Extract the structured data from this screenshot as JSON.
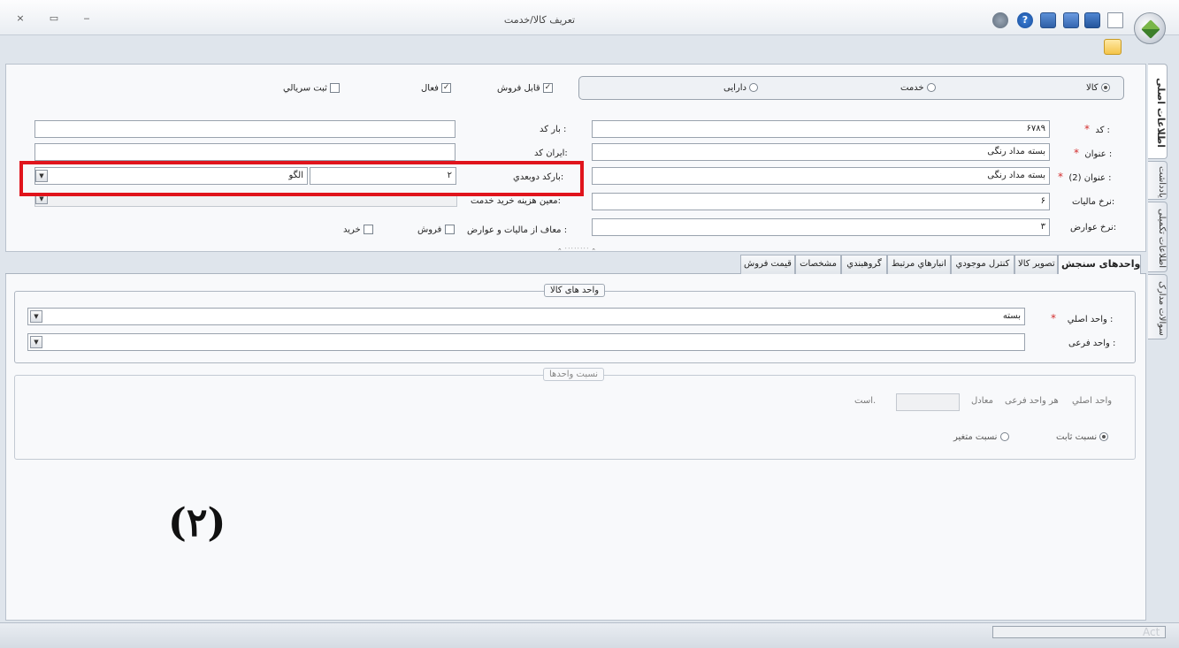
{
  "window": {
    "title": "تعریف کالا/خدمت",
    "buttons": {
      "close": "×",
      "restore": "▭",
      "minimize": "‒"
    }
  },
  "toolbar": {
    "icons": [
      "new-document-icon",
      "save-icon",
      "save-as-icon",
      "save-all-icon",
      "help-icon",
      "tools-icon"
    ]
  },
  "side_tabs": [
    "اطلاعات اصلی",
    "یادداشت",
    "اطلاعات تکمیلی",
    "سوالات مدارک"
  ],
  "type_selector": {
    "options": [
      "کالا",
      "خدمت",
      "دارایی"
    ],
    "selected": "کالا"
  },
  "checkboxes": {
    "sellable": {
      "label": "قابل فروش",
      "checked": true
    },
    "active": {
      "label": "فعال",
      "checked": true
    },
    "serial": {
      "label": "ثبت سريالي",
      "checked": false
    }
  },
  "form": {
    "code": {
      "label": "کد :",
      "value": "۶۷۸۹",
      "required": "*"
    },
    "title": {
      "label": "عنوان :",
      "value": "بسته مداد رنگی",
      "required": "*"
    },
    "title2": {
      "label": "عنوان (2) :",
      "value": "بسته مداد رنگی",
      "required": "*"
    },
    "tax_rate": {
      "label": "نرخ ماليات:",
      "value": "۶"
    },
    "duty_rate": {
      "label": "نرخ عوارض:",
      "value": "۳"
    },
    "barcode": {
      "label": "بار کد :",
      "value": ""
    },
    "iran_code": {
      "label": "ايران کد:",
      "value": ""
    },
    "barcode2d": {
      "label": "بارکد دوبعدي:",
      "value_left": "الگو",
      "value_right": "۲"
    },
    "service_cost": {
      "label": "معين هزينه خريد خدمت:",
      "value": ""
    },
    "exempt": {
      "label": "معاف از ماليات و عوارض :",
      "sale": {
        "label": "فروش",
        "checked": false
      },
      "purchase": {
        "label": "خريد",
        "checked": false
      }
    }
  },
  "bottom_tabs": [
    "واحدهای سنجش",
    "تصوير کالا",
    "کنترل موجودي",
    "انبارهاي مرتبط",
    "گروهبندي",
    "مشخصات",
    "قيمت فروش"
  ],
  "units_group": {
    "title": "واحد های کالا",
    "main_unit": {
      "label": "واحد اصلي :",
      "value": "بسته",
      "required": "*"
    },
    "sub_unit": {
      "label": "واحد فرعی :",
      "value": ""
    }
  },
  "ratio_group": {
    "title": "نسبت واحدها",
    "sentence": [
      "واحد اصلي",
      "هر واحد فرعی",
      "معادل",
      "است."
    ],
    "fixed": {
      "label": "نسبت ثابت",
      "selected": true
    },
    "variable": {
      "label": "نسبت متغير",
      "selected": false
    }
  },
  "annotation": "(۲)",
  "watermark": "Act",
  "colors": {
    "highlight": "#e0141c",
    "required": "#d32f2f"
  }
}
